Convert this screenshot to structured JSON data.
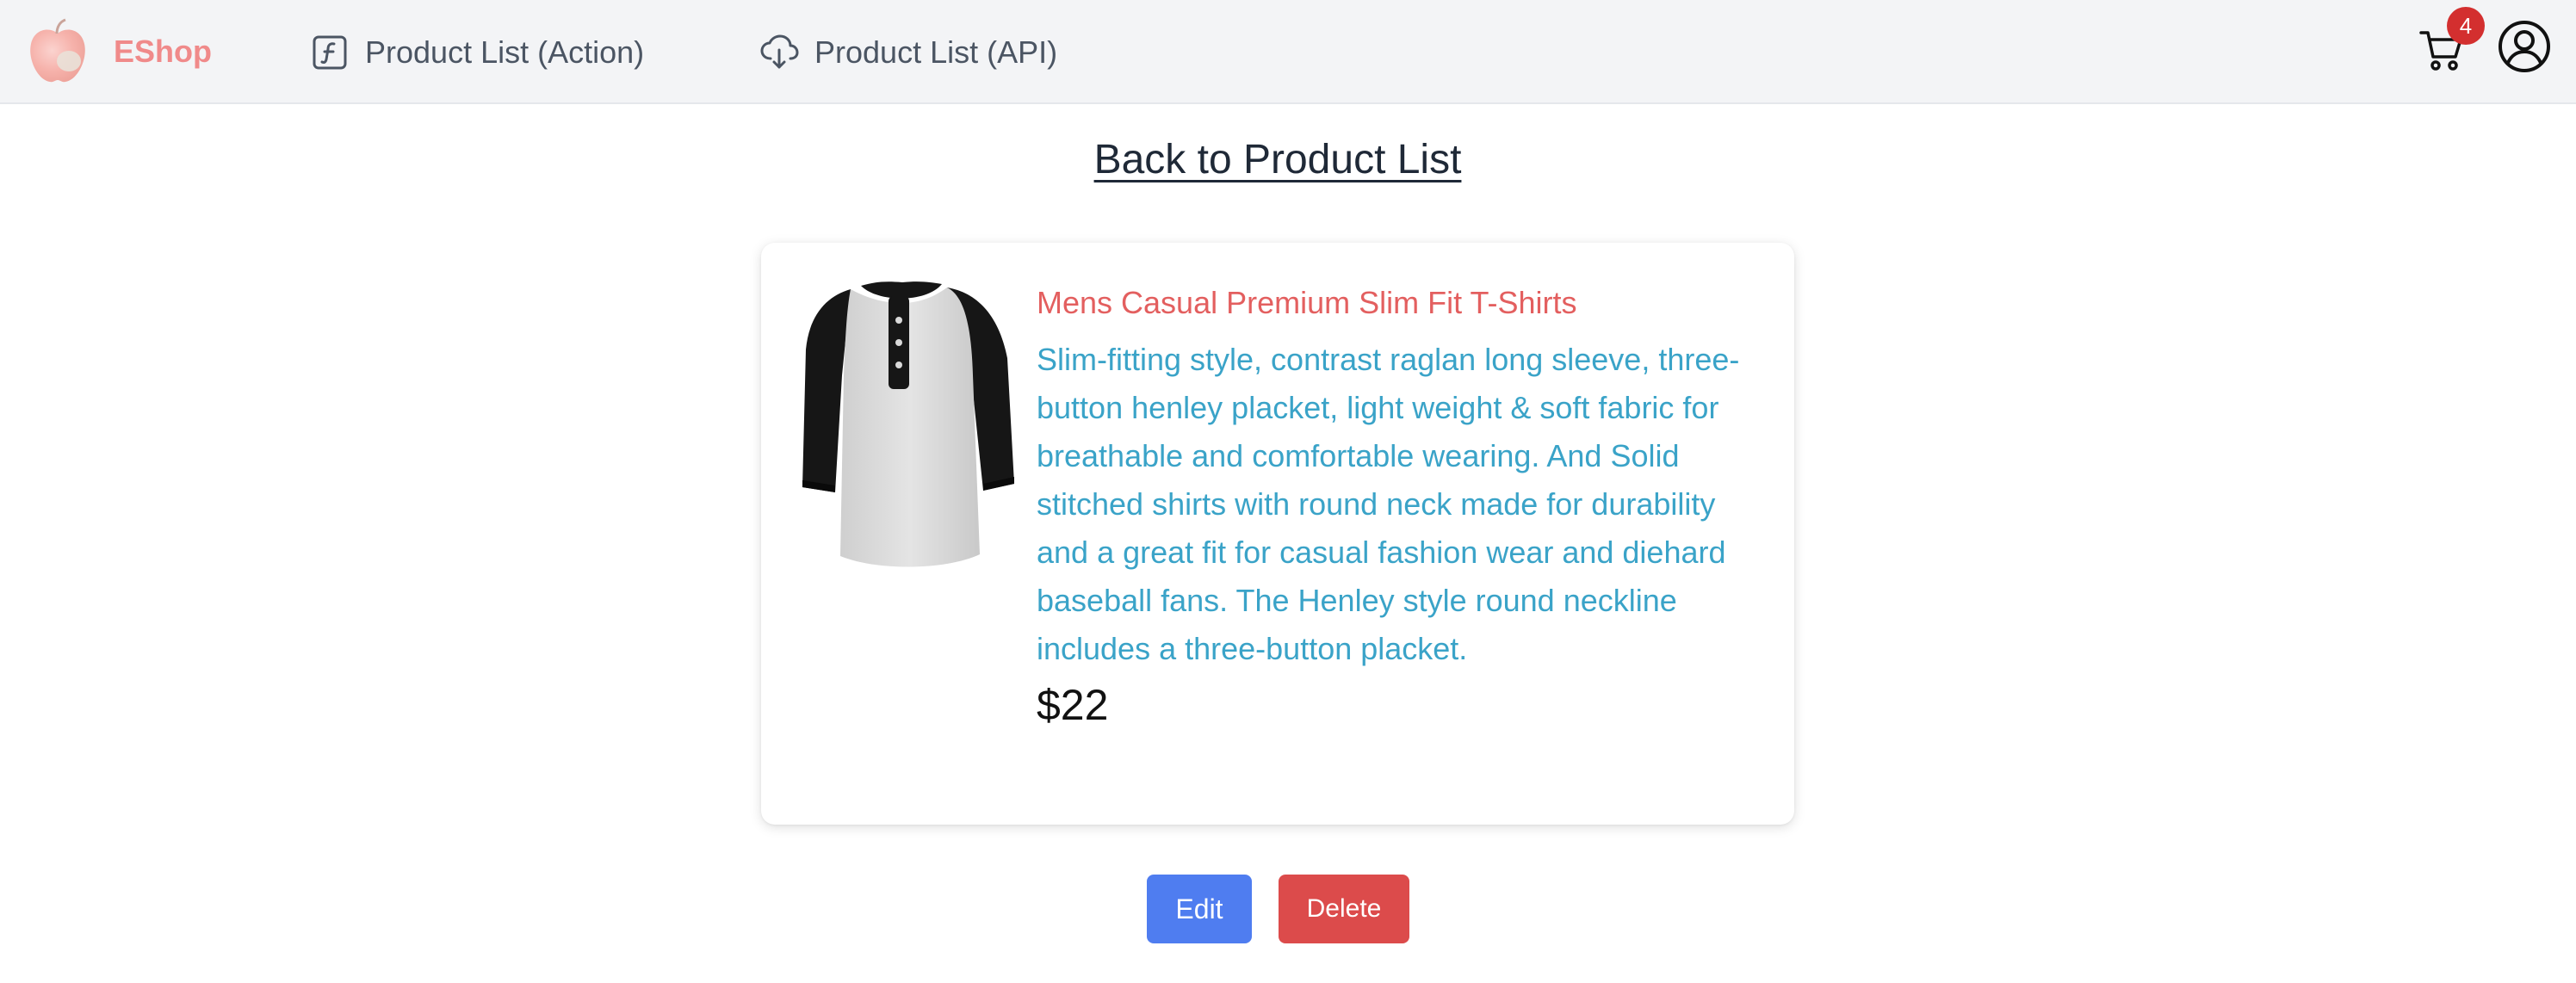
{
  "brand": {
    "name": "EShop",
    "logo_icon": "apple-logo-icon",
    "color": "#f08a8a"
  },
  "nav": {
    "items": [
      {
        "label": "Product List (Action)",
        "icon": "function-icon"
      },
      {
        "label": "Product List (API)",
        "icon": "cloud-download-icon"
      }
    ]
  },
  "header": {
    "cart_icon": "shopping-cart-icon",
    "cart_count": "4",
    "account_icon": "user-circle-icon"
  },
  "main": {
    "back_link": "Back to Product List"
  },
  "product": {
    "image_icon": "henley-shirt-image",
    "title": "Mens Casual Premium Slim Fit T-Shirts",
    "description": "Slim-fitting style, contrast raglan long sleeve, three-button henley placket, light weight & soft fabric for breathable and comfortable wearing. And Solid stitched shirts with round neck made for durability and a great fit for casual fashion wear and diehard baseball fans. The Henley style round neckline includes a three-button placket.",
    "price": "$22"
  },
  "actions": {
    "edit_label": "Edit",
    "delete_label": "Delete"
  },
  "colors": {
    "title": "#e35f5f",
    "description": "#3aa3c8",
    "edit_button": "#4f7df0",
    "delete_button": "#dc4b4b",
    "badge": "#d32f2f"
  }
}
